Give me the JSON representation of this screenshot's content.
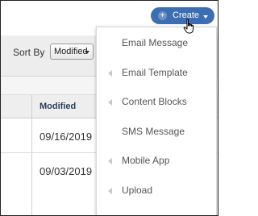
{
  "toolbar": {
    "sort_label": "Sort By",
    "sort_value": "Modified"
  },
  "table": {
    "column_header": "Modified",
    "rows": [
      "09/16/2019",
      "09/03/2019"
    ]
  },
  "create_button": {
    "label": "Create",
    "icon": "plus-circle-icon",
    "color": "#3d6eb3"
  },
  "menu": {
    "items": [
      {
        "label": "Email Message",
        "submenu": false
      },
      {
        "label": "Email Template",
        "submenu": true
      },
      {
        "label": "Content Blocks",
        "submenu": true
      },
      {
        "label": "SMS Message",
        "submenu": false
      },
      {
        "label": "Mobile App",
        "submenu": true
      },
      {
        "label": "Upload",
        "submenu": true
      }
    ]
  }
}
